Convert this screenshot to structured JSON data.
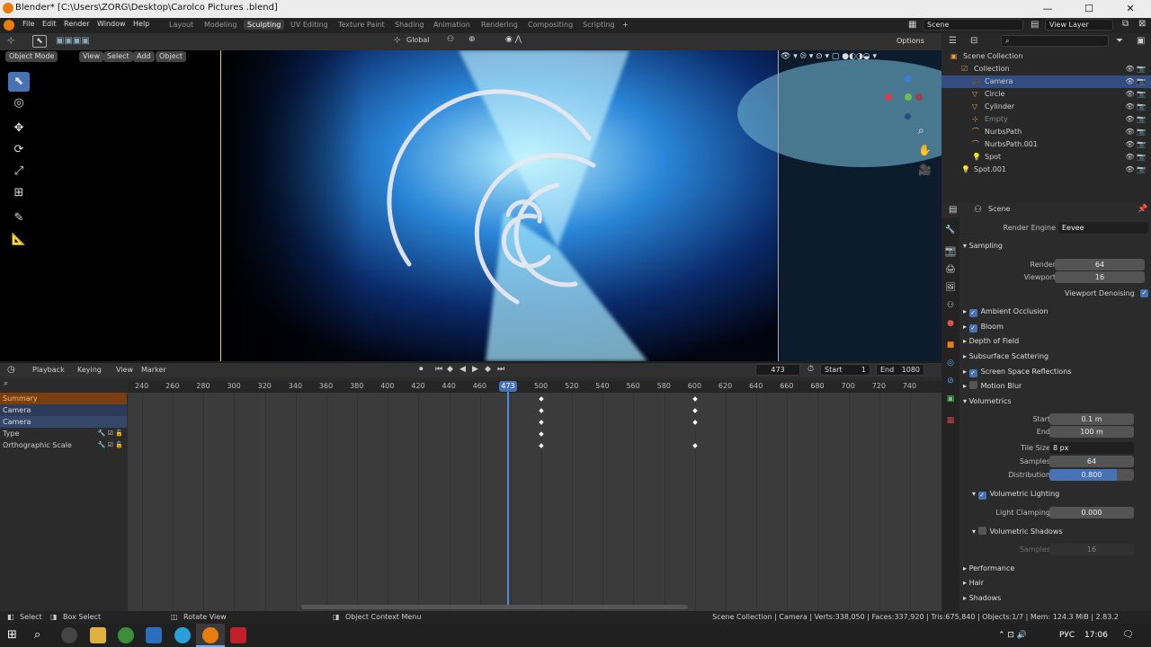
{
  "window": {
    "title": "Blender* [C:\\Users\\ZORG\\Desktop\\Carolco Pictures .blend]",
    "minimize": "—",
    "maximize": "☐",
    "close": "✕"
  },
  "menu": [
    "File",
    "Edit",
    "Render",
    "Window",
    "Help"
  ],
  "workspaces": [
    "Layout",
    "Modeling",
    "Sculpting",
    "UV Editing",
    "Texture Paint",
    "Shading",
    "Animation",
    "Rendering",
    "Compositing",
    "Scripting",
    "+"
  ],
  "active_workspace": "Sculpting",
  "scene_field": "Scene",
  "view_layer_field": "View Layer",
  "header3d": {
    "transform_orientation": "Global",
    "options": "Options",
    "mode": "Object Mode",
    "view": "View",
    "select": "Select",
    "add": "Add",
    "object": "Object"
  },
  "timeline": {
    "playback": "Playback",
    "keying": "Keying",
    "view": "View",
    "marker": "Marker",
    "current_frame": "473",
    "start_label": "Start",
    "start_value": "1",
    "end_label": "End",
    "end_value": "1080",
    "ruler": [
      "240",
      "260",
      "280",
      "300",
      "320",
      "340",
      "360",
      "380",
      "400",
      "420",
      "440",
      "460",
      "480",
      "500",
      "520",
      "540",
      "560",
      "580",
      "600",
      "620",
      "640",
      "660",
      "680",
      "700",
      "720",
      "740"
    ],
    "playhead_label": "473",
    "channels": [
      {
        "label": "Summary",
        "style": "summary"
      },
      {
        "label": "Camera",
        "style": "object"
      },
      {
        "label": "Camera",
        "style": "action"
      },
      {
        "label": "Type",
        "style": "prop"
      },
      {
        "label": "Orthographic Scale",
        "style": "prop"
      }
    ],
    "keyframe_frames": [
      500,
      600
    ]
  },
  "outliner": {
    "search_placeholder": "",
    "rows": [
      {
        "label": "Scene Collection",
        "indent": 0,
        "icon": "scene-collection-icon",
        "selected": false
      },
      {
        "label": "Collection",
        "indent": 1,
        "icon": "collection-icon",
        "selected": false
      },
      {
        "label": "Camera",
        "indent": 2,
        "icon": "camera-icon",
        "selected": true
      },
      {
        "label": "Circle",
        "indent": 2,
        "icon": "curve-icon",
        "selected": false
      },
      {
        "label": "Cylinder",
        "indent": 2,
        "icon": "mesh-icon",
        "selected": false
      },
      {
        "label": "Empty",
        "indent": 2,
        "icon": "empty-icon",
        "selected": false
      },
      {
        "label": "NurbsPath",
        "indent": 2,
        "icon": "nurbs-icon",
        "selected": false
      },
      {
        "label": "NurbsPath.001",
        "indent": 2,
        "icon": "nurbs-icon",
        "selected": false
      },
      {
        "label": "Spot",
        "indent": 2,
        "icon": "light-icon",
        "selected": false
      },
      {
        "label": "Spot.001",
        "indent": 1,
        "icon": "light-icon",
        "selected": false
      }
    ]
  },
  "properties": {
    "context": "Scene",
    "render_engine_label": "Render Engine",
    "render_engine": "Eevee",
    "sampling": "Sampling",
    "render_label": "Render",
    "render_value": "64",
    "viewport_label": "Viewport",
    "viewport_value": "16",
    "viewport_denoising": "Viewport Denoising",
    "ambient_occlusion": "Ambient Occlusion",
    "bloom": "Bloom",
    "depth_of_field": "Depth of Field",
    "subsurface_scattering": "Subsurface Scattering",
    "ssr": "Screen Space Reflections",
    "motion_blur": "Motion Blur",
    "volumetrics": "Volumetrics",
    "start_label": "Start",
    "start_value": "0.1 m",
    "end_label": "End",
    "end_value": "100 m",
    "tile_size_label": "Tile Size",
    "tile_size_value": "8 px",
    "samples_label": "Samples",
    "samples_value": "64",
    "distribution_label": "Distribution",
    "distribution_value": "0.800",
    "volumetric_lighting": "Volumetric Lighting",
    "light_clamping_label": "Light Clamping",
    "light_clamping_value": "0.000",
    "volumetric_shadows": "Volumetric Shadows",
    "vs_samples_label": "Samples",
    "vs_samples_value": "16",
    "performance": "Performance",
    "hair": "Hair",
    "shadows": "Shadows"
  },
  "status": {
    "select": "Select",
    "box_select": "Box Select",
    "rotate_view": "Rotate View",
    "context_menu": "Object Context Menu",
    "stats": "Scene Collection | Camera | Verts:338,050 | Faces:337,920 | Tris:675,840 | Objects:1/7 | Mem: 124.3 MiB | 2.83.2"
  },
  "taskbar": {
    "lang": "РУС",
    "time": "17:06"
  },
  "colors": {
    "accent": "#4772b3",
    "orange": "#e87d0d",
    "selection": "#334d80"
  }
}
